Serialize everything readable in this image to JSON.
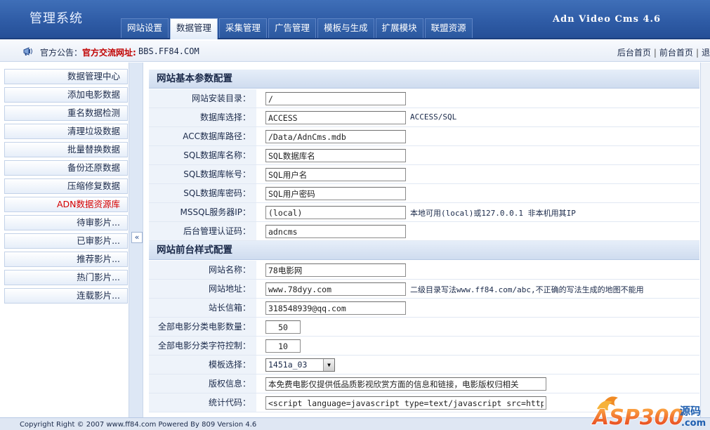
{
  "header": {
    "app_title": "管理系统",
    "version": "Adn Video Cms 4.6",
    "tabs": [
      {
        "label": "网站设置",
        "active": false
      },
      {
        "label": "数据管理",
        "active": true
      },
      {
        "label": "采集管理",
        "active": false
      },
      {
        "label": "广告管理",
        "active": false
      },
      {
        "label": "模板与生成",
        "active": false
      },
      {
        "label": "扩展模块",
        "active": false
      },
      {
        "label": "联盟资源",
        "active": false
      }
    ]
  },
  "notice": {
    "label": "官方公告：",
    "link_text": "官方交流网址:",
    "url_text": "BBS.FF84.COM",
    "links": [
      "后台首页",
      "前台首页",
      "退"
    ],
    "separator": "|"
  },
  "sidebar": {
    "items": [
      {
        "label": "数据管理中心",
        "highlight": false
      },
      {
        "label": "添加电影数据",
        "highlight": false
      },
      {
        "label": "重名数据检测",
        "highlight": false
      },
      {
        "label": "清理垃圾数据",
        "highlight": false
      },
      {
        "label": "批量替换数据",
        "highlight": false
      },
      {
        "label": "备份还原数据",
        "highlight": false
      },
      {
        "label": "压缩修复数据",
        "highlight": false
      },
      {
        "label": "ADN数据资源库",
        "highlight": true
      },
      {
        "label": "待审影片...",
        "highlight": false
      },
      {
        "label": "已审影片...",
        "highlight": false
      },
      {
        "label": "推荐影片...",
        "highlight": false
      },
      {
        "label": "热门影片...",
        "highlight": false
      },
      {
        "label": "连载影片...",
        "highlight": false
      }
    ],
    "collapse_glyph": "«"
  },
  "main": {
    "section1": {
      "title": "网站基本参数配置",
      "rows": [
        {
          "label": "网站安装目录：",
          "value": "/",
          "hint": ""
        },
        {
          "label": "数据库选择：",
          "value": "ACCESS",
          "hint": "ACCESS/SQL"
        },
        {
          "label": "ACC数据库路径：",
          "value": "/Data/AdnCms.mdb",
          "hint": ""
        },
        {
          "label": "SQL数据库名称：",
          "value": "SQL数据库名",
          "hint": ""
        },
        {
          "label": "SQL数据库帐号：",
          "value": "SQL用户名",
          "hint": ""
        },
        {
          "label": "SQL数据库密码：",
          "value": "SQL用户密码",
          "hint": ""
        },
        {
          "label": "MSSQL服务器IP：",
          "value": "(local)",
          "hint": "本地可用(local)或127.0.0.1 非本机用其IP"
        },
        {
          "label": "后台管理认证码：",
          "value": "adncms",
          "hint": ""
        }
      ]
    },
    "section2": {
      "title": "网站前台样式配置",
      "rows": [
        {
          "label": "网站名称：",
          "value": "78电影网",
          "hint": ""
        },
        {
          "label": "网站地址：",
          "value": "www.78dyy.com",
          "hint": "二级目录写法www.ff84.com/abc,不正确的写法生成的地图不能用"
        },
        {
          "label": "站长信箱：",
          "value": "318548939@qq.com",
          "hint": ""
        },
        {
          "label": "全部电影分类电影数量：",
          "value": "50",
          "hint": ""
        },
        {
          "label": "全部电影分类字符控制：",
          "value": "10",
          "hint": ""
        },
        {
          "label": "模板选择：",
          "value": "1451a_03",
          "hint": ""
        },
        {
          "label": "版权信息：",
          "value": "本免费电影仅提供低品质影视欣赏方面的信息和链接，电影版权归相关",
          "hint": ""
        },
        {
          "label": "统计代码：",
          "value": "<script language=javascript type=text/javascript src=http",
          "hint": ""
        }
      ]
    }
  },
  "footer": {
    "text": "Copyright Right © 2007 www.ff84.com Powered By 809 Version 4.6"
  },
  "watermark": {
    "brand": "ASP300",
    "cn_text": "源码",
    "domain": ".com"
  }
}
